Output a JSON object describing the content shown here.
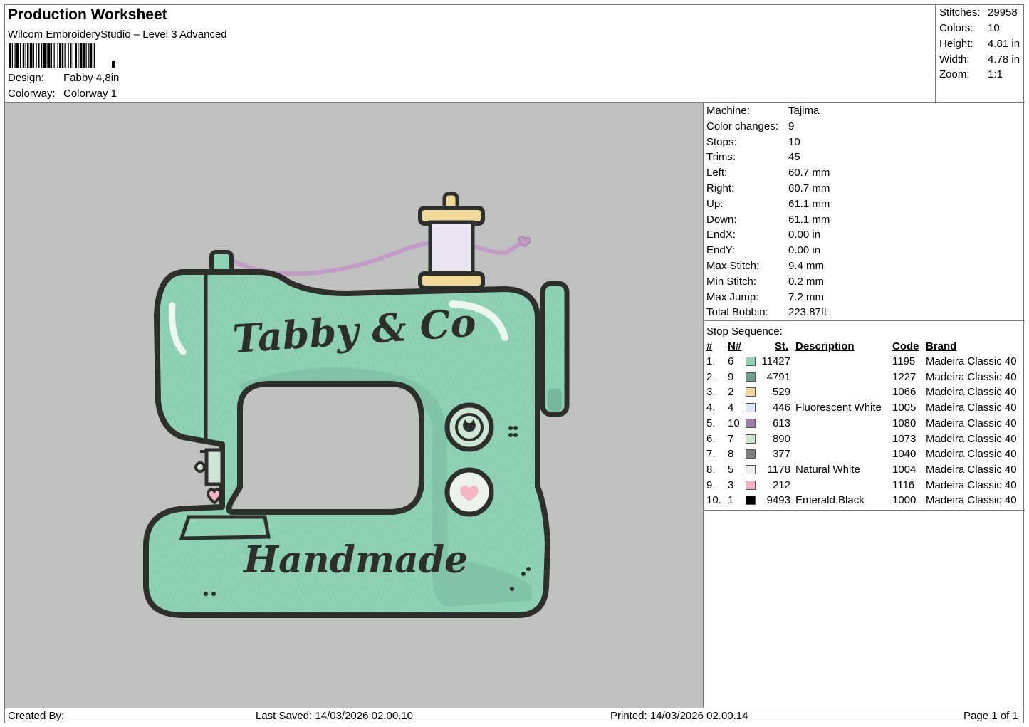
{
  "header": {
    "title": "Production Worksheet",
    "subtitle": "Wilcom EmbroideryStudio – Level 3 Advanced",
    "design_label": "Design:",
    "design_value": "Fabby 4,8in",
    "colorway_label": "Colorway:",
    "colorway_value": "Colorway 1"
  },
  "summary": [
    {
      "label": "Stitches:",
      "value": "29958"
    },
    {
      "label": "Colors:",
      "value": "10"
    },
    {
      "label": "Height:",
      "value": "4.81 in"
    },
    {
      "label": "Width:",
      "value": "4.78 in"
    },
    {
      "label": "Zoom:",
      "value": "1:1"
    }
  ],
  "design": {
    "text_top": "Tabby & Co",
    "text_bottom": "Handmade",
    "colors": {
      "body": "#8fd1b5",
      "body_shadow": "#79b8a0",
      "outline": "#2d2f2c",
      "thread": "#c19ac6",
      "spool_thread": "#e8e4f0",
      "spool_cap": "#f1d99a",
      "heart": "#f4b5c4",
      "canvas": "#c0c0c0"
    }
  },
  "stats": [
    {
      "label": "Machine:",
      "value": "Tajima"
    },
    {
      "label": "Color changes:",
      "value": "9"
    },
    {
      "label": "Stops:",
      "value": "10"
    },
    {
      "label": "Trims:",
      "value": "45"
    },
    {
      "label": "Left:",
      "value": "60.7 mm"
    },
    {
      "label": "Right:",
      "value": "60.7 mm"
    },
    {
      "label": "Up:",
      "value": "61.1 mm"
    },
    {
      "label": "Down:",
      "value": "61.1 mm"
    },
    {
      "label": "EndX:",
      "value": "0.00 in"
    },
    {
      "label": "EndY:",
      "value": "0.00 in"
    },
    {
      "label": "Max Stitch:",
      "value": "9.4 mm"
    },
    {
      "label": "Min Stitch:",
      "value": "0.2 mm"
    },
    {
      "label": "Max Jump:",
      "value": "7.2 mm"
    },
    {
      "label": "Total Bobbin:",
      "value": "223.87ft"
    }
  ],
  "stop_sequence": {
    "title": "Stop Sequence:",
    "headers": {
      "num": "#",
      "n": "N#",
      "st": "St.",
      "desc": "Description",
      "code": "Code",
      "brand": "Brand"
    },
    "rows": [
      {
        "num": "1.",
        "n": "6",
        "color": "#8fcfb3",
        "st": "11427",
        "desc": "",
        "code": "1195",
        "brand": "Madeira Classic 40"
      },
      {
        "num": "2.",
        "n": "9",
        "color": "#6f9e8c",
        "st": "4791",
        "desc": "",
        "code": "1227",
        "brand": "Madeira Classic 40"
      },
      {
        "num": "3.",
        "n": "2",
        "color": "#f6d59a",
        "st": "529",
        "desc": "",
        "code": "1066",
        "brand": "Madeira Classic 40"
      },
      {
        "num": "4.",
        "n": "4",
        "color": "#e2e4f8",
        "st": "446",
        "desc": "Fluorescent White",
        "code": "1005",
        "brand": "Madeira Classic 40"
      },
      {
        "num": "5.",
        "n": "10",
        "color": "#a27aae",
        "st": "613",
        "desc": "",
        "code": "1080",
        "brand": "Madeira Classic 40"
      },
      {
        "num": "6.",
        "n": "7",
        "color": "#cde6d4",
        "st": "890",
        "desc": "",
        "code": "1073",
        "brand": "Madeira Classic 40"
      },
      {
        "num": "7.",
        "n": "8",
        "color": "#7e7e7e",
        "st": "377",
        "desc": "",
        "code": "1040",
        "brand": "Madeira Classic 40"
      },
      {
        "num": "8.",
        "n": "5",
        "color": "#eeeeee",
        "st": "1178",
        "desc": "Natural White",
        "code": "1004",
        "brand": "Madeira Classic 40"
      },
      {
        "num": "9.",
        "n": "3",
        "color": "#f3b3c2",
        "st": "212",
        "desc": "",
        "code": "1116",
        "brand": "Madeira Classic 40"
      },
      {
        "num": "10.",
        "n": "1",
        "color": "#000000",
        "st": "9493",
        "desc": "Emerald Black",
        "code": "1000",
        "brand": "Madeira Classic 40"
      }
    ]
  },
  "footer": {
    "created_by": "Created By:",
    "last_saved": "Last Saved: 14/03/2026 02.00.10",
    "printed": "Printed: 14/03/2026 02.00.14",
    "page": "Page 1 of 1"
  }
}
